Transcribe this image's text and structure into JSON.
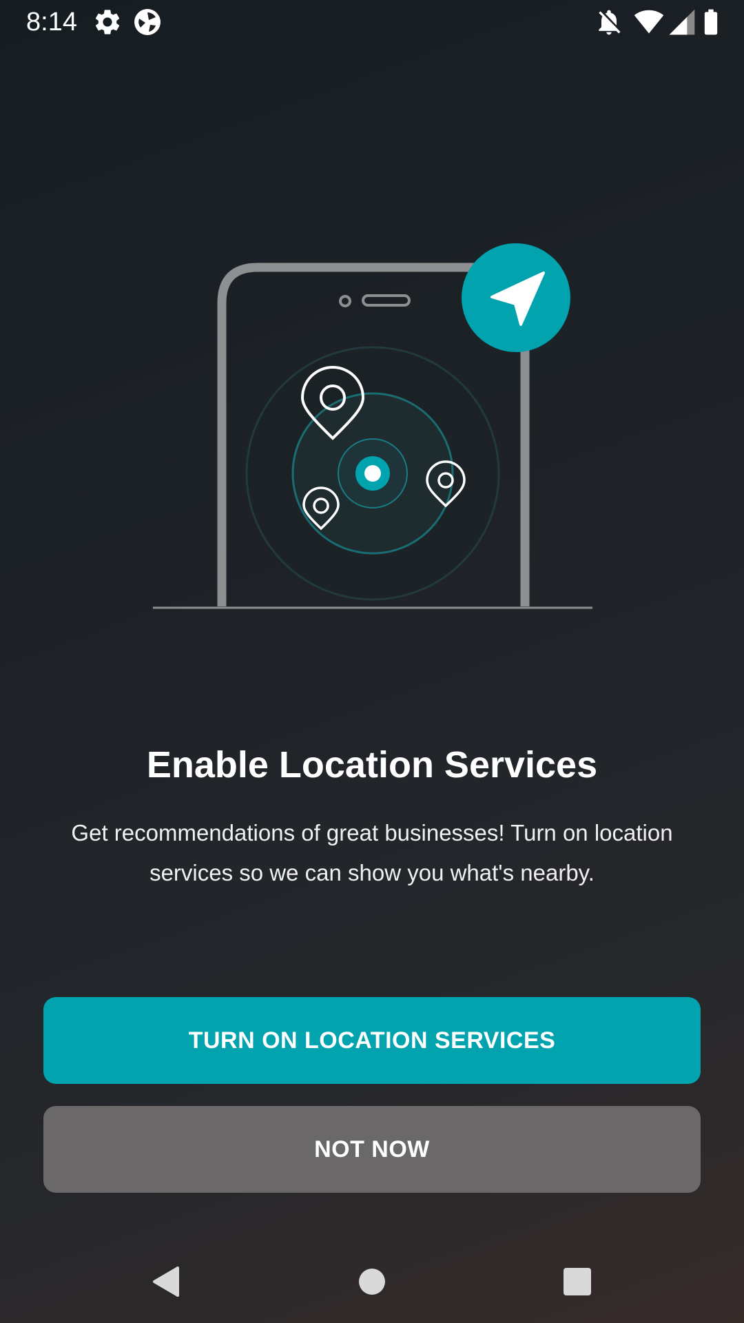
{
  "status_bar": {
    "time": "8:14",
    "icons": [
      "settings-gear-icon",
      "app-shutter-icon",
      "notifications-off-icon",
      "wifi-icon",
      "cell-signal-icon",
      "battery-icon"
    ]
  },
  "illustration": {
    "description_icons": [
      "phone-outline",
      "navigation-arrow-icon",
      "map-pin-icon",
      "current-location-dot"
    ],
    "accent_color": "#00a3ae"
  },
  "prompt": {
    "title": "Enable Location Services",
    "body": "Get recommendations of great businesses! Turn on location services so we can show you what's nearby."
  },
  "actions": {
    "primary_label": "TURN ON LOCATION SERVICES",
    "secondary_label": "NOT NOW",
    "primary_color": "#00a3ae",
    "secondary_color": "#6a6869"
  },
  "nav_bar": {
    "buttons": [
      "back-icon",
      "home-icon",
      "recents-icon"
    ]
  }
}
